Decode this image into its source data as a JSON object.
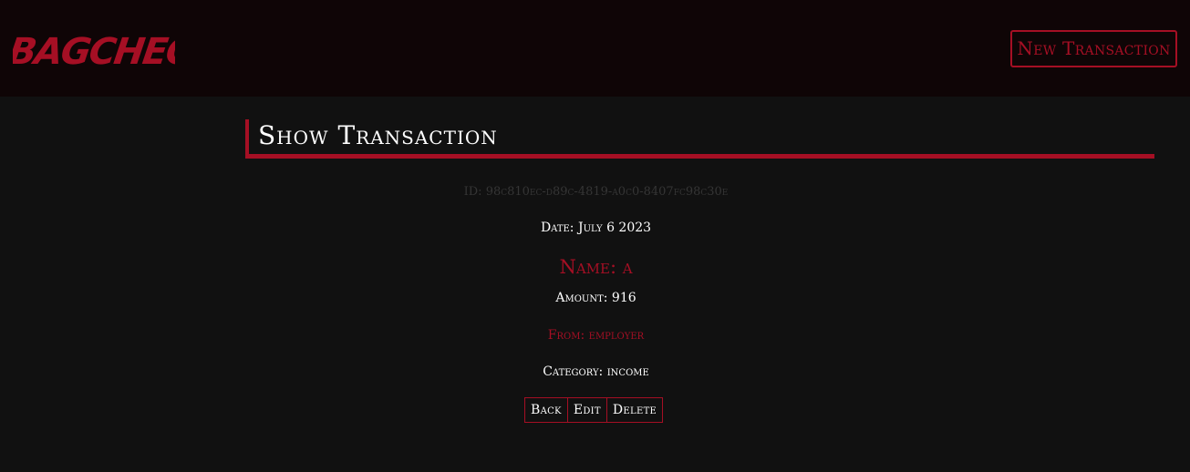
{
  "header": {
    "logo_text": "BAGCHECK",
    "new_transaction_label": "New Transaction"
  },
  "page": {
    "title": "Show Transaction"
  },
  "transaction": {
    "id_text": "ID: 98c810ec-d89c-4819-a0c0-8407fc98c30e",
    "date_text": "Date: July 6 2023",
    "name_text": "Name: a",
    "amount_text": "Amount: 916",
    "from_text": "From: employer",
    "category_text": "Category: income"
  },
  "actions": {
    "back_label": "Back",
    "edit_label": "Edit",
    "delete_label": "Delete"
  },
  "colors": {
    "accent": "#a50f24",
    "background": "#111111",
    "header_background": "#0f0506",
    "text": "#ffffff",
    "muted": "#353535"
  }
}
